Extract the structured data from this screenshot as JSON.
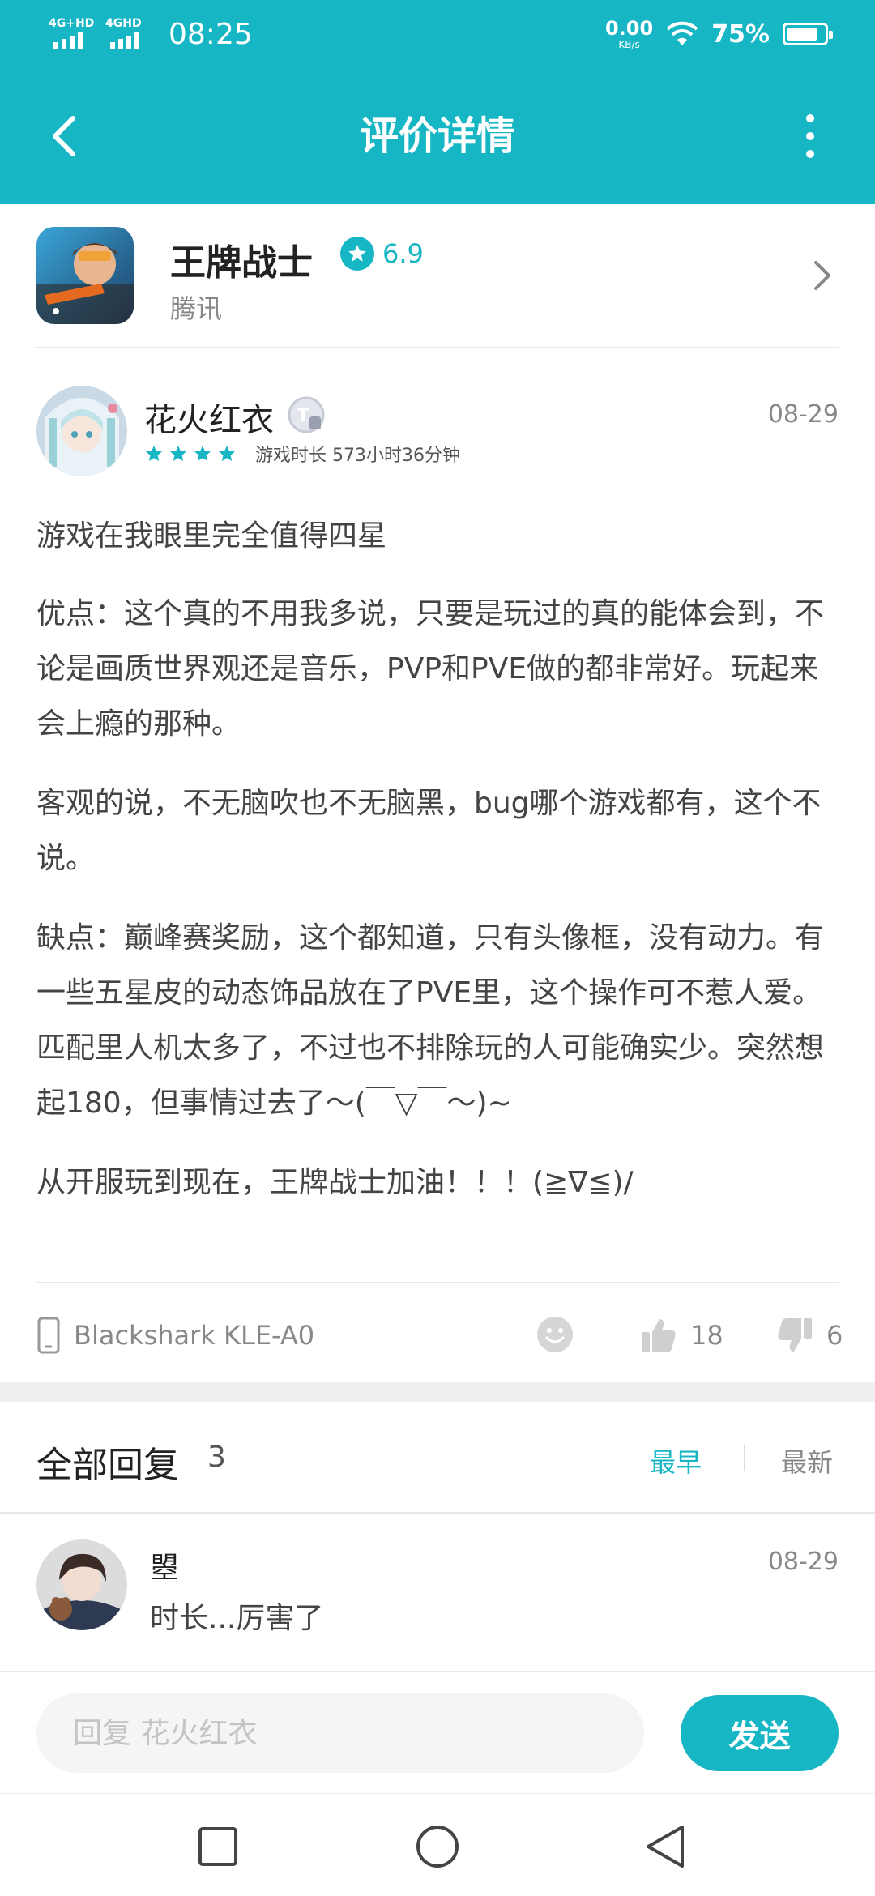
{
  "status_bar": {
    "sim1_tag": "4G+HD",
    "sim2_tag": "4GHD",
    "time": "08:25",
    "net_speed_value": "0.00",
    "net_speed_unit": "KB/s",
    "battery_percent": "75%",
    "battery_level": 0.75
  },
  "header": {
    "title": "评价详情",
    "back_icon": "chevron-left-icon",
    "more_icon": "more-vertical-icon"
  },
  "game": {
    "name": "王牌战士",
    "rating": "6.9",
    "developer": "腾讯"
  },
  "review": {
    "user_name": "花火红衣",
    "level_badge": "T",
    "stars": 4,
    "play_time": "游戏时长 573小时36分钟",
    "date": "08-29",
    "paragraphs": [
      "游戏在我眼里完全值得四星",
      "优点：这个真的不用我多说，只要是玩过的真的能体会到，不论是画质世界观还是音乐，PVP和PVE做的都非常好。玩起来会上瘾的那种。",
      "客观的说，不无脑吹也不无脑黑，bug哪个游戏都有，这个不说。",
      "缺点：巅峰赛奖励，这个都知道，只有头像框，没有动力。有一些五星皮的动态饰品放在了PVE里，这个操作可不惹人爱。匹配里人机太多了，不过也不排除玩的人可能确实少。突然想起180，但事情过去了～(￣▽￣～)~",
      "从开服玩到现在，王牌战士加油！！！(≧∇≦)/"
    ],
    "device": "Blackshark KLE-A0",
    "likes": "18",
    "dislikes": "6"
  },
  "replies": {
    "title": "全部回复",
    "count": "3",
    "sort_earliest": "最早",
    "sort_newest": "最新",
    "items": [
      {
        "user_name": "曌",
        "date": "08-29",
        "text": "时长...厉害了"
      }
    ]
  },
  "composer": {
    "placeholder": "回复 花火红衣",
    "send_label": "发送"
  },
  "colors": {
    "accent": "#17b6c5",
    "text_primary": "#222222",
    "text_secondary": "#888888"
  }
}
